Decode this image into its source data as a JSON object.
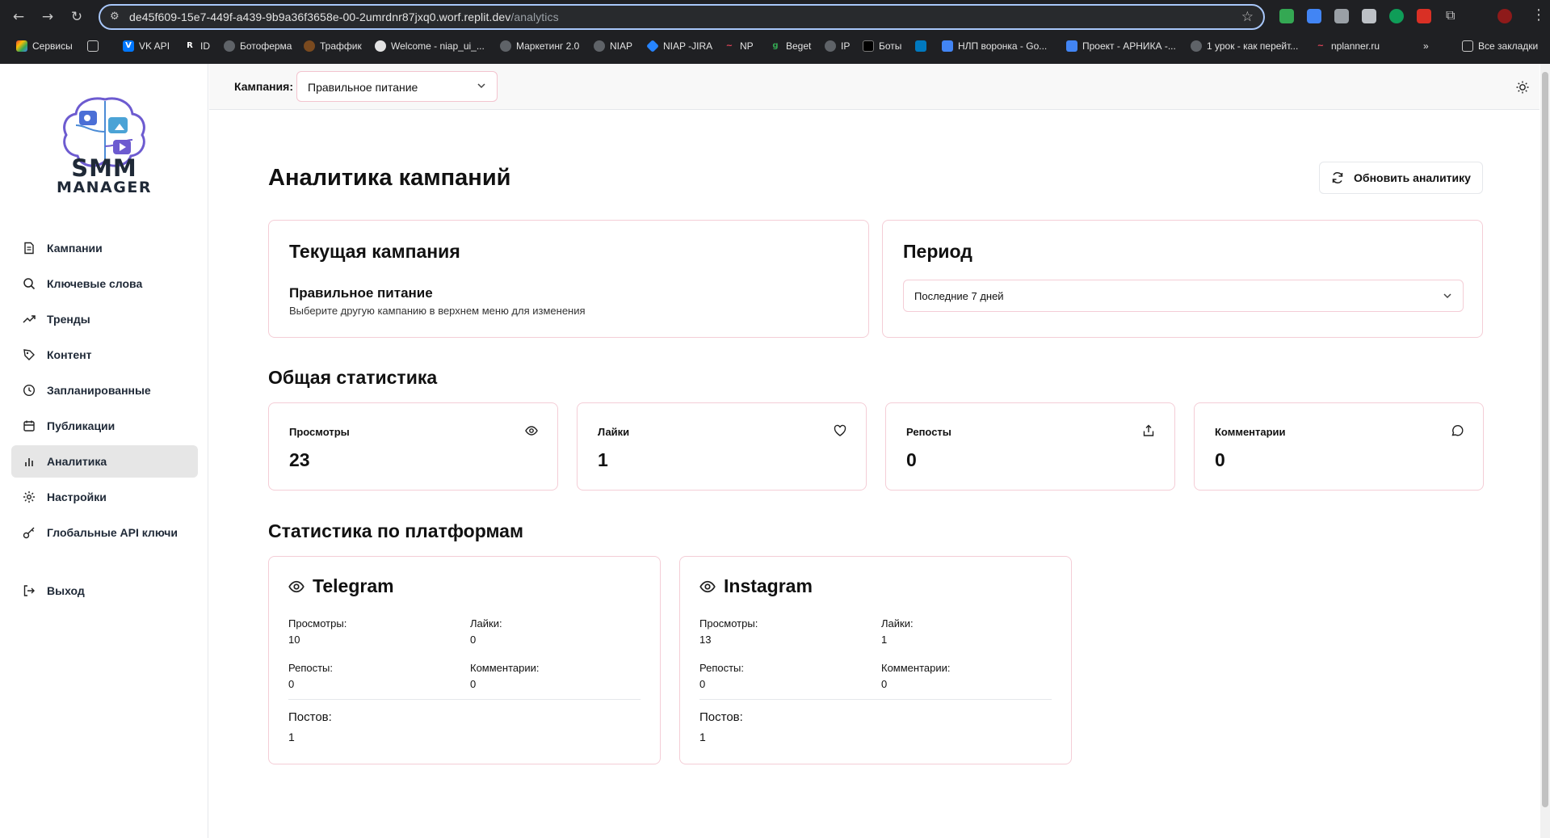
{
  "browser": {
    "url_host": "de45f609-15e7-449f-a439-9b9a36f3658e-00-2umrdnr87jxq0.worf.replit.dev",
    "url_path": "/analytics",
    "bookmarks": [
      "Сервисы",
      "VK API",
      "ID",
      "Ботоферма",
      "Траффик",
      "Welcome - niap_ui_...",
      "Маркетинг 2.0",
      "NIAP",
      "NIAP -JIRA",
      "NP",
      "Beget",
      "IP",
      "Боты",
      "НЛП воронка - Go...",
      "Проект - АРНИКА -...",
      "1 урок - как перейт...",
      "nplanner.ru"
    ],
    "all_bookmarks": "Все закладки"
  },
  "brand": {
    "line1": "SMM",
    "line2": "MANAGER"
  },
  "sidebar": {
    "items": [
      {
        "label": "Кампании",
        "icon": "file-icon"
      },
      {
        "label": "Ключевые слова",
        "icon": "search-icon"
      },
      {
        "label": "Тренды",
        "icon": "trend-icon"
      },
      {
        "label": "Контент",
        "icon": "brush-icon"
      },
      {
        "label": "Запланированные",
        "icon": "clock-icon"
      },
      {
        "label": "Публикации",
        "icon": "calendar-icon"
      },
      {
        "label": "Аналитика",
        "icon": "bar-chart-icon"
      },
      {
        "label": "Настройки",
        "icon": "gear-icon"
      },
      {
        "label": "Глобальные API ключи",
        "icon": "key-icon"
      }
    ],
    "active": "Аналитика",
    "logout": "Выход"
  },
  "topbar": {
    "campaign_label": "Кампания:",
    "campaign_value": "Правильное питание"
  },
  "main": {
    "title": "Аналитика кампаний",
    "refresh": "Обновить аналитику",
    "current": {
      "heading": "Текущая кампания",
      "name": "Правильное питание",
      "hint": "Выберите другую кампанию в верхнем меню для изменения"
    },
    "period": {
      "heading": "Период",
      "value": "Последние 7 дней"
    },
    "overall_title": "Общая статистика",
    "stats": [
      {
        "label": "Просмотры",
        "value": "23",
        "icon": "eye-icon"
      },
      {
        "label": "Лайки",
        "value": "1",
        "icon": "heart-icon"
      },
      {
        "label": "Репосты",
        "value": "0",
        "icon": "share-icon"
      },
      {
        "label": "Комментарии",
        "value": "0",
        "icon": "comment-icon"
      }
    ],
    "platform_title": "Статистика по платформам",
    "platforms": [
      {
        "name": "Telegram",
        "views_label": "Просмотры:",
        "views": "10",
        "likes_label": "Лайки:",
        "likes": "0",
        "reposts_label": "Репосты:",
        "reposts": "0",
        "comments_label": "Комментарии:",
        "comments": "0",
        "posts_label": "Постов:",
        "posts": "1"
      },
      {
        "name": "Instagram",
        "views_label": "Просмотры:",
        "views": "13",
        "likes_label": "Лайки:",
        "likes": "1",
        "reposts_label": "Репосты:",
        "reposts": "0",
        "comments_label": "Комментарии:",
        "comments": "0",
        "posts_label": "Постов:",
        "posts": "1"
      }
    ]
  }
}
